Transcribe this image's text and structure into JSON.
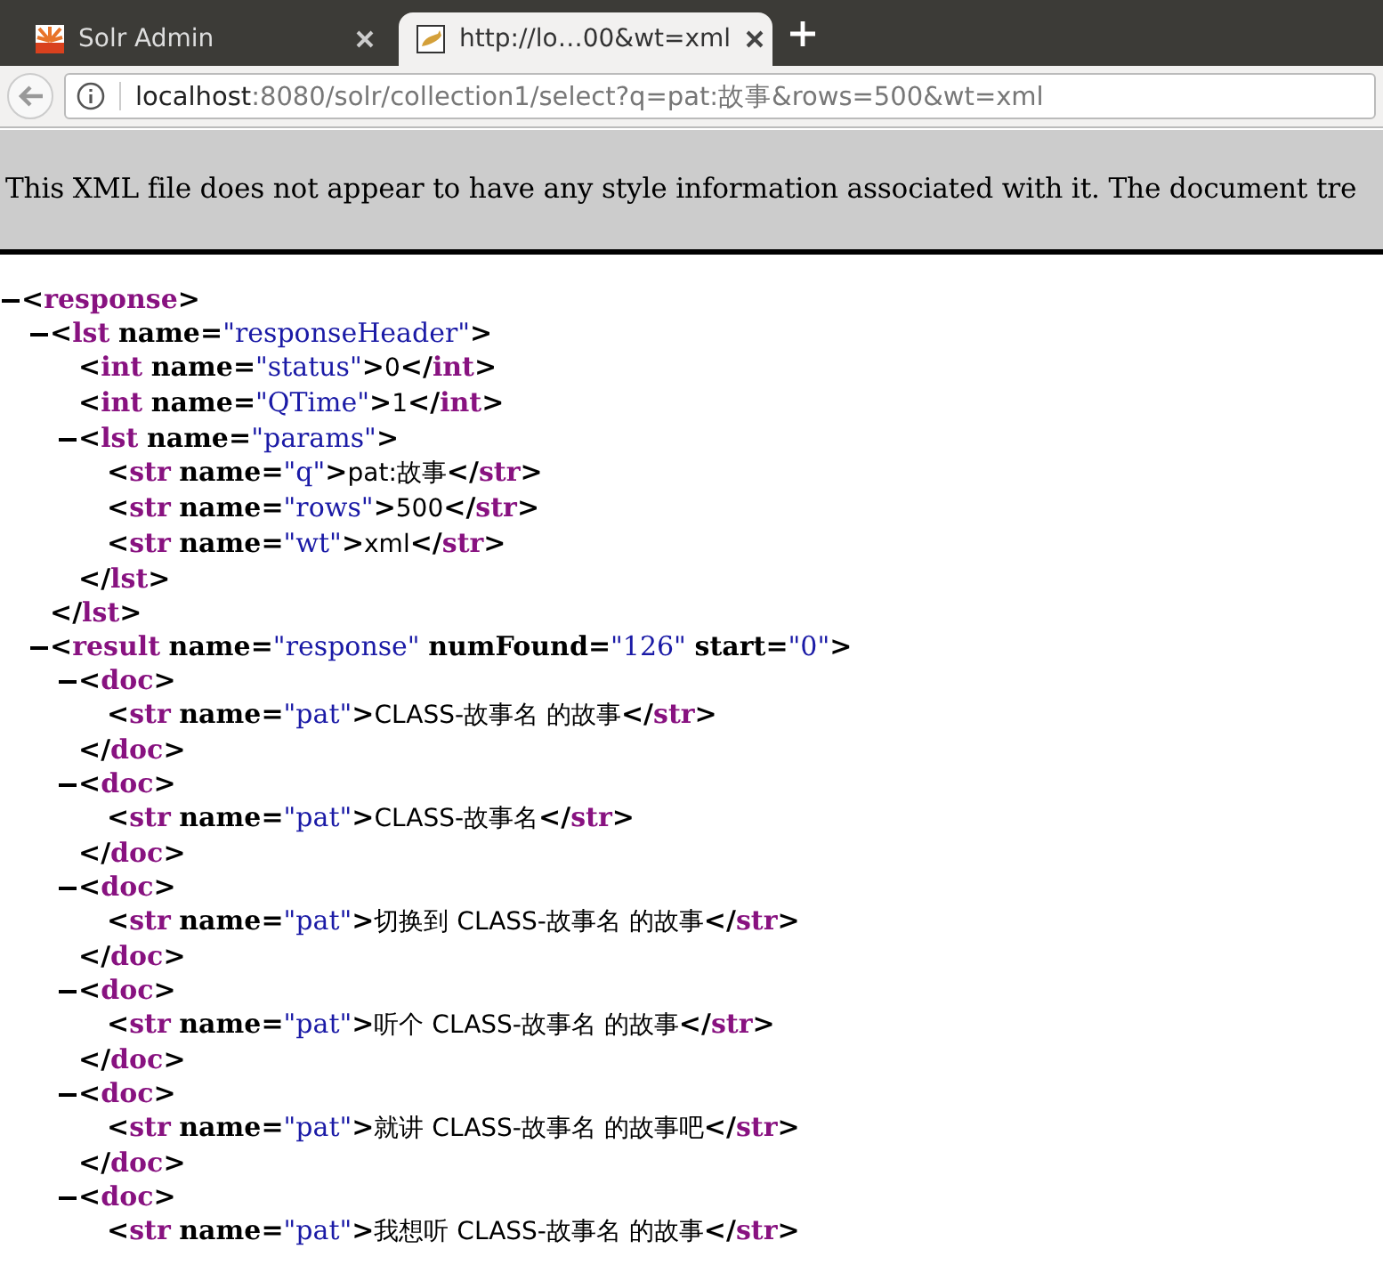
{
  "tabs": [
    {
      "title": "Solr Admin",
      "selected": false
    },
    {
      "title": "http://lo…00&wt=xml",
      "selected": true
    }
  ],
  "address_bar": {
    "host": "localhost",
    "path": ":8080/solr/collection1/select?q=pat:故事&rows=500&wt=xml"
  },
  "info_banner": "This XML file does not appear to have any style information associated with it. The document tre",
  "xml_tree": [
    {
      "expanded": true,
      "open": [
        {
          "kind": "punct",
          "text": "<"
        },
        {
          "kind": "tag",
          "text": "response"
        },
        {
          "kind": "punct",
          "text": ">"
        }
      ],
      "children": [
        {
          "expanded": true,
          "open": [
            {
              "kind": "punct",
              "text": "<"
            },
            {
              "kind": "tag",
              "text": "lst"
            },
            {
              "kind": "attr",
              "text": "name"
            },
            {
              "kind": "punct",
              "text": "="
            },
            {
              "kind": "value",
              "text": "\"responseHeader\""
            },
            {
              "kind": "punct",
              "text": ">"
            }
          ],
          "children": [
            {
              "line": [
                {
                  "kind": "punct",
                  "text": "<"
                },
                {
                  "kind": "tag",
                  "text": "int"
                },
                {
                  "kind": "attr",
                  "text": "name"
                },
                {
                  "kind": "punct",
                  "text": "="
                },
                {
                  "kind": "value",
                  "text": "\"status\""
                },
                {
                  "kind": "punct",
                  "text": ">"
                },
                {
                  "kind": "text",
                  "text": "0"
                },
                {
                  "kind": "punct",
                  "text": "</"
                },
                {
                  "kind": "tag",
                  "text": "int"
                },
                {
                  "kind": "punct",
                  "text": ">"
                }
              ]
            },
            {
              "line": [
                {
                  "kind": "punct",
                  "text": "<"
                },
                {
                  "kind": "tag",
                  "text": "int"
                },
                {
                  "kind": "attr",
                  "text": "name"
                },
                {
                  "kind": "punct",
                  "text": "="
                },
                {
                  "kind": "value",
                  "text": "\"QTime\""
                },
                {
                  "kind": "punct",
                  "text": ">"
                },
                {
                  "kind": "text",
                  "text": "1"
                },
                {
                  "kind": "punct",
                  "text": "</"
                },
                {
                  "kind": "tag",
                  "text": "int"
                },
                {
                  "kind": "punct",
                  "text": ">"
                }
              ]
            },
            {
              "expanded": true,
              "open": [
                {
                  "kind": "punct",
                  "text": "<"
                },
                {
                  "kind": "tag",
                  "text": "lst"
                },
                {
                  "kind": "attr",
                  "text": "name"
                },
                {
                  "kind": "punct",
                  "text": "="
                },
                {
                  "kind": "value",
                  "text": "\"params\""
                },
                {
                  "kind": "punct",
                  "text": ">"
                }
              ],
              "children": [
                {
                  "line": [
                    {
                      "kind": "punct",
                      "text": "<"
                    },
                    {
                      "kind": "tag",
                      "text": "str"
                    },
                    {
                      "kind": "attr",
                      "text": "name"
                    },
                    {
                      "kind": "punct",
                      "text": "="
                    },
                    {
                      "kind": "value",
                      "text": "\"q\""
                    },
                    {
                      "kind": "punct",
                      "text": ">"
                    },
                    {
                      "kind": "text",
                      "text": "pat:故事"
                    },
                    {
                      "kind": "punct",
                      "text": "</"
                    },
                    {
                      "kind": "tag",
                      "text": "str"
                    },
                    {
                      "kind": "punct",
                      "text": ">"
                    }
                  ]
                },
                {
                  "line": [
                    {
                      "kind": "punct",
                      "text": "<"
                    },
                    {
                      "kind": "tag",
                      "text": "str"
                    },
                    {
                      "kind": "attr",
                      "text": "name"
                    },
                    {
                      "kind": "punct",
                      "text": "="
                    },
                    {
                      "kind": "value",
                      "text": "\"rows\""
                    },
                    {
                      "kind": "punct",
                      "text": ">"
                    },
                    {
                      "kind": "text",
                      "text": "500"
                    },
                    {
                      "kind": "punct",
                      "text": "</"
                    },
                    {
                      "kind": "tag",
                      "text": "str"
                    },
                    {
                      "kind": "punct",
                      "text": ">"
                    }
                  ]
                },
                {
                  "line": [
                    {
                      "kind": "punct",
                      "text": "<"
                    },
                    {
                      "kind": "tag",
                      "text": "str"
                    },
                    {
                      "kind": "attr",
                      "text": "name"
                    },
                    {
                      "kind": "punct",
                      "text": "="
                    },
                    {
                      "kind": "value",
                      "text": "\"wt\""
                    },
                    {
                      "kind": "punct",
                      "text": ">"
                    },
                    {
                      "kind": "text",
                      "text": "xml"
                    },
                    {
                      "kind": "punct",
                      "text": "</"
                    },
                    {
                      "kind": "tag",
                      "text": "str"
                    },
                    {
                      "kind": "punct",
                      "text": ">"
                    }
                  ]
                }
              ],
              "close": [
                {
                  "kind": "punct",
                  "text": "</"
                },
                {
                  "kind": "tag",
                  "text": "lst"
                },
                {
                  "kind": "punct",
                  "text": ">"
                }
              ]
            }
          ],
          "close": [
            {
              "kind": "punct",
              "text": "</"
            },
            {
              "kind": "tag",
              "text": "lst"
            },
            {
              "kind": "punct",
              "text": ">"
            }
          ]
        },
        {
          "expanded": true,
          "open": [
            {
              "kind": "punct",
              "text": "<"
            },
            {
              "kind": "tag",
              "text": "result"
            },
            {
              "kind": "attr",
              "text": "name"
            },
            {
              "kind": "punct",
              "text": "="
            },
            {
              "kind": "value",
              "text": "\"response\""
            },
            {
              "kind": "attr",
              "text": "numFound"
            },
            {
              "kind": "punct",
              "text": "="
            },
            {
              "kind": "value",
              "text": "\"126\""
            },
            {
              "kind": "attr",
              "text": "start"
            },
            {
              "kind": "punct",
              "text": "="
            },
            {
              "kind": "value",
              "text": "\"0\""
            },
            {
              "kind": "punct",
              "text": ">"
            }
          ],
          "children": [
            {
              "expanded": true,
              "open": [
                {
                  "kind": "punct",
                  "text": "<"
                },
                {
                  "kind": "tag",
                  "text": "doc"
                },
                {
                  "kind": "punct",
                  "text": ">"
                }
              ],
              "children": [
                {
                  "line": [
                    {
                      "kind": "punct",
                      "text": "<"
                    },
                    {
                      "kind": "tag",
                      "text": "str"
                    },
                    {
                      "kind": "attr",
                      "text": "name"
                    },
                    {
                      "kind": "punct",
                      "text": "="
                    },
                    {
                      "kind": "value",
                      "text": "\"pat\""
                    },
                    {
                      "kind": "punct",
                      "text": ">"
                    },
                    {
                      "kind": "text",
                      "text": "CLASS-故事名 的故事"
                    },
                    {
                      "kind": "punct",
                      "text": "</"
                    },
                    {
                      "kind": "tag",
                      "text": "str"
                    },
                    {
                      "kind": "punct",
                      "text": ">"
                    }
                  ]
                }
              ],
              "close": [
                {
                  "kind": "punct",
                  "text": "</"
                },
                {
                  "kind": "tag",
                  "text": "doc"
                },
                {
                  "kind": "punct",
                  "text": ">"
                }
              ]
            },
            {
              "expanded": true,
              "open": [
                {
                  "kind": "punct",
                  "text": "<"
                },
                {
                  "kind": "tag",
                  "text": "doc"
                },
                {
                  "kind": "punct",
                  "text": ">"
                }
              ],
              "children": [
                {
                  "line": [
                    {
                      "kind": "punct",
                      "text": "<"
                    },
                    {
                      "kind": "tag",
                      "text": "str"
                    },
                    {
                      "kind": "attr",
                      "text": "name"
                    },
                    {
                      "kind": "punct",
                      "text": "="
                    },
                    {
                      "kind": "value",
                      "text": "\"pat\""
                    },
                    {
                      "kind": "punct",
                      "text": ">"
                    },
                    {
                      "kind": "text",
                      "text": "CLASS-故事名"
                    },
                    {
                      "kind": "punct",
                      "text": "</"
                    },
                    {
                      "kind": "tag",
                      "text": "str"
                    },
                    {
                      "kind": "punct",
                      "text": ">"
                    }
                  ]
                }
              ],
              "close": [
                {
                  "kind": "punct",
                  "text": "</"
                },
                {
                  "kind": "tag",
                  "text": "doc"
                },
                {
                  "kind": "punct",
                  "text": ">"
                }
              ]
            },
            {
              "expanded": true,
              "open": [
                {
                  "kind": "punct",
                  "text": "<"
                },
                {
                  "kind": "tag",
                  "text": "doc"
                },
                {
                  "kind": "punct",
                  "text": ">"
                }
              ],
              "children": [
                {
                  "line": [
                    {
                      "kind": "punct",
                      "text": "<"
                    },
                    {
                      "kind": "tag",
                      "text": "str"
                    },
                    {
                      "kind": "attr",
                      "text": "name"
                    },
                    {
                      "kind": "punct",
                      "text": "="
                    },
                    {
                      "kind": "value",
                      "text": "\"pat\""
                    },
                    {
                      "kind": "punct",
                      "text": ">"
                    },
                    {
                      "kind": "text",
                      "text": "切换到 CLASS-故事名 的故事"
                    },
                    {
                      "kind": "punct",
                      "text": "</"
                    },
                    {
                      "kind": "tag",
                      "text": "str"
                    },
                    {
                      "kind": "punct",
                      "text": ">"
                    }
                  ]
                }
              ],
              "close": [
                {
                  "kind": "punct",
                  "text": "</"
                },
                {
                  "kind": "tag",
                  "text": "doc"
                },
                {
                  "kind": "punct",
                  "text": ">"
                }
              ]
            },
            {
              "expanded": true,
              "open": [
                {
                  "kind": "punct",
                  "text": "<"
                },
                {
                  "kind": "tag",
                  "text": "doc"
                },
                {
                  "kind": "punct",
                  "text": ">"
                }
              ],
              "children": [
                {
                  "line": [
                    {
                      "kind": "punct",
                      "text": "<"
                    },
                    {
                      "kind": "tag",
                      "text": "str"
                    },
                    {
                      "kind": "attr",
                      "text": "name"
                    },
                    {
                      "kind": "punct",
                      "text": "="
                    },
                    {
                      "kind": "value",
                      "text": "\"pat\""
                    },
                    {
                      "kind": "punct",
                      "text": ">"
                    },
                    {
                      "kind": "text",
                      "text": "听个 CLASS-故事名 的故事"
                    },
                    {
                      "kind": "punct",
                      "text": "</"
                    },
                    {
                      "kind": "tag",
                      "text": "str"
                    },
                    {
                      "kind": "punct",
                      "text": ">"
                    }
                  ]
                }
              ],
              "close": [
                {
                  "kind": "punct",
                  "text": "</"
                },
                {
                  "kind": "tag",
                  "text": "doc"
                },
                {
                  "kind": "punct",
                  "text": ">"
                }
              ]
            },
            {
              "expanded": true,
              "open": [
                {
                  "kind": "punct",
                  "text": "<"
                },
                {
                  "kind": "tag",
                  "text": "doc"
                },
                {
                  "kind": "punct",
                  "text": ">"
                }
              ],
              "children": [
                {
                  "line": [
                    {
                      "kind": "punct",
                      "text": "<"
                    },
                    {
                      "kind": "tag",
                      "text": "str"
                    },
                    {
                      "kind": "attr",
                      "text": "name"
                    },
                    {
                      "kind": "punct",
                      "text": "="
                    },
                    {
                      "kind": "value",
                      "text": "\"pat\""
                    },
                    {
                      "kind": "punct",
                      "text": ">"
                    },
                    {
                      "kind": "text",
                      "text": "就讲 CLASS-故事名 的故事吧"
                    },
                    {
                      "kind": "punct",
                      "text": "</"
                    },
                    {
                      "kind": "tag",
                      "text": "str"
                    },
                    {
                      "kind": "punct",
                      "text": ">"
                    }
                  ]
                }
              ],
              "close": [
                {
                  "kind": "punct",
                  "text": "</"
                },
                {
                  "kind": "tag",
                  "text": "doc"
                },
                {
                  "kind": "punct",
                  "text": ">"
                }
              ]
            },
            {
              "expanded": true,
              "open": [
                {
                  "kind": "punct",
                  "text": "<"
                },
                {
                  "kind": "tag",
                  "text": "doc"
                },
                {
                  "kind": "punct",
                  "text": ">"
                }
              ],
              "children": [
                {
                  "line": [
                    {
                      "kind": "punct",
                      "text": "<"
                    },
                    {
                      "kind": "tag",
                      "text": "str"
                    },
                    {
                      "kind": "attr",
                      "text": "name"
                    },
                    {
                      "kind": "punct",
                      "text": "="
                    },
                    {
                      "kind": "value",
                      "text": "\"pat\""
                    },
                    {
                      "kind": "punct",
                      "text": ">"
                    },
                    {
                      "kind": "text",
                      "text": "我想听 CLASS-故事名 的故事"
                    },
                    {
                      "kind": "punct",
                      "text": "</"
                    },
                    {
                      "kind": "tag",
                      "text": "str"
                    },
                    {
                      "kind": "punct",
                      "text": ">"
                    }
                  ]
                }
              ]
            }
          ]
        }
      ]
    }
  ]
}
